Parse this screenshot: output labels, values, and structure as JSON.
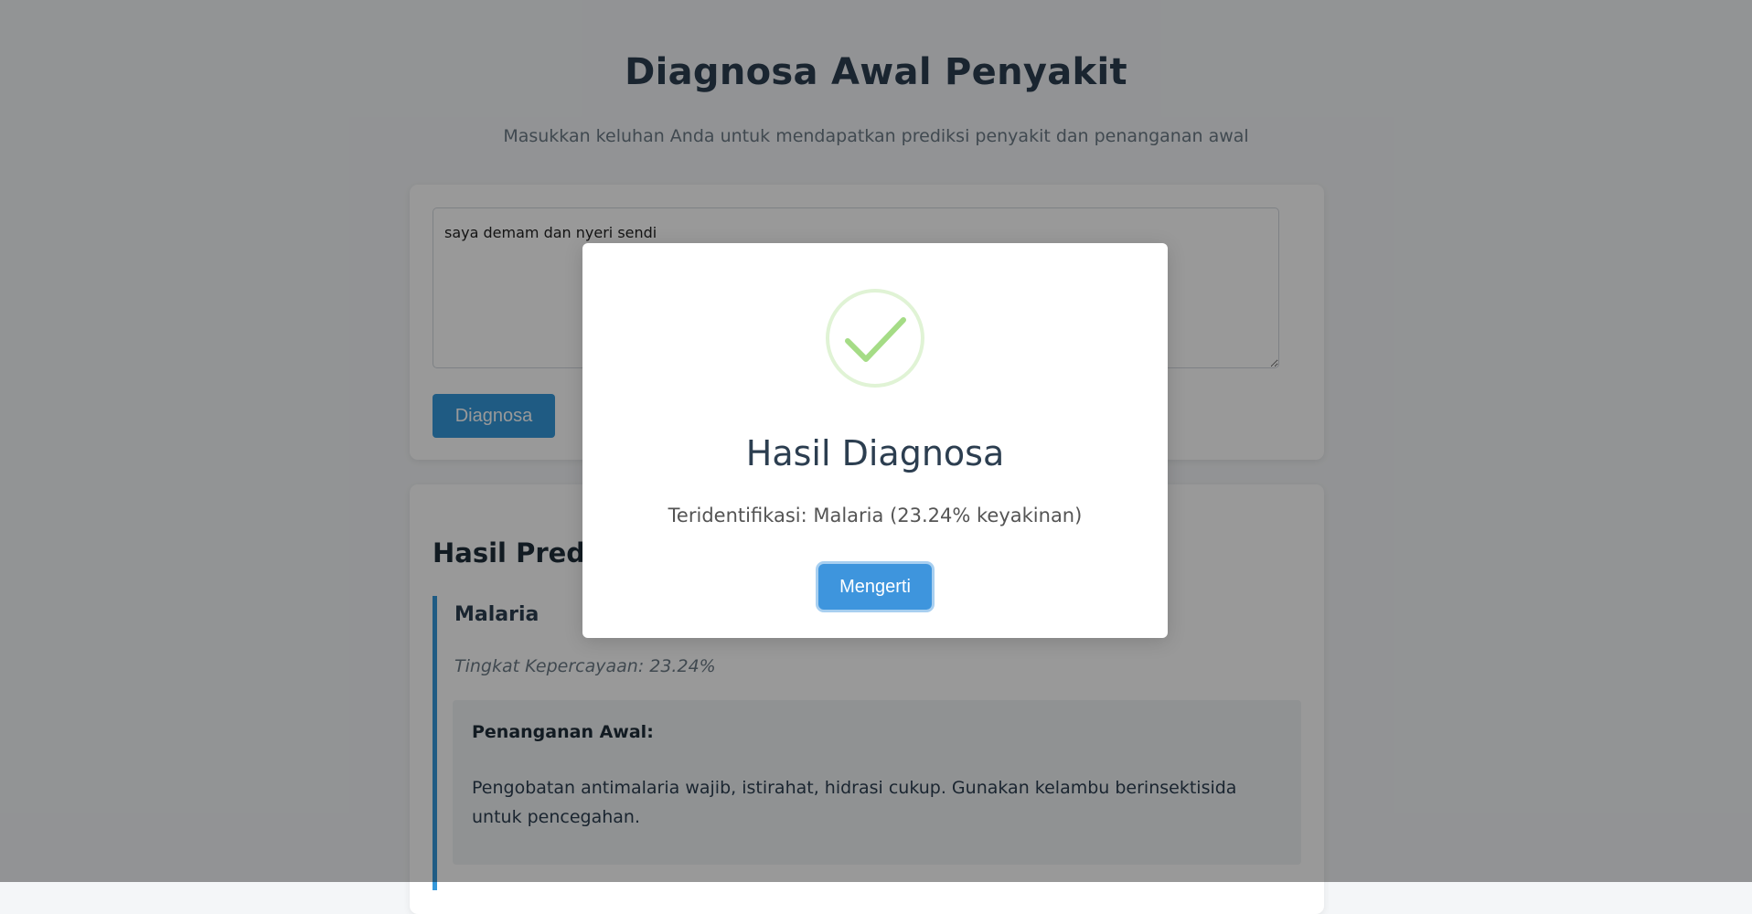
{
  "page": {
    "title": "Diagnosa Awal Penyakit",
    "subtitle": "Masukkan keluhan Anda untuk mendapatkan prediksi penyakit dan penanganan awal"
  },
  "form": {
    "symptom_value": "saya demam dan nyeri sendi",
    "submit_label": "Diagnosa"
  },
  "results": {
    "heading": "Hasil Prediksi",
    "prediction": {
      "disease": "Malaria",
      "confidence_text": "Tingkat Kepercayaan: 23.24%",
      "treatment_label": "Penanganan Awal:",
      "treatment_text": "Pengobatan antimalaria wajib, istirahat, hidrasi cukup. Gunakan kelambu berinsektisida untuk pencegahan."
    }
  },
  "modal": {
    "icon": "success-check-icon",
    "title": "Hasil Diagnosa",
    "message": "Teridentifikasi: Malaria (23.24% keyakinan)",
    "confirm_label": "Mengerti"
  },
  "colors": {
    "accent": "#3498db",
    "success": "#a5dc86",
    "title": "#2c3e50"
  }
}
